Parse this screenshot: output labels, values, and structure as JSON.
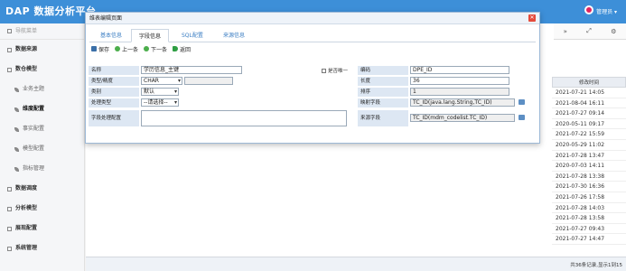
{
  "app": {
    "title": "DAP 数据分析平台"
  },
  "user": {
    "name": "管理员 ▾"
  },
  "sidebar": {
    "header": "导航菜单",
    "items": [
      {
        "label": "数据来源",
        "type": "group"
      },
      {
        "label": "数仓模型",
        "type": "group"
      },
      {
        "label": "业务主题",
        "type": "sub"
      },
      {
        "label": "维度配置",
        "type": "sub",
        "active": true
      },
      {
        "label": "事实配置",
        "type": "sub"
      },
      {
        "label": "模型配置",
        "type": "sub"
      },
      {
        "label": "指标管理",
        "type": "sub"
      },
      {
        "label": "数据调度",
        "type": "group"
      },
      {
        "label": "分析模型",
        "type": "group"
      },
      {
        "label": "展现配置",
        "type": "group"
      },
      {
        "label": "系统管理",
        "type": "group"
      }
    ]
  },
  "toolbar": {
    "icons": [
      "»",
      "⤢",
      "⚙"
    ]
  },
  "table": {
    "modified_header": "修改时间",
    "modified_times": [
      "2021-07-21 14:05",
      "2021-08-04 16:11",
      "2021-07-27 09:14",
      "2020-05-11 09:17",
      "2021-07-22 15:59",
      "2020-05-29 11:02",
      "2021-07-28 13:47",
      "2020-07-03 14:11",
      "2021-07-28 13:38",
      "2021-07-30 16:36",
      "2021-07-26 17:58",
      "2021-07-28 14:03",
      "2021-07-28 13:58",
      "2021-07-27 09:43",
      "2021-07-27 14:47"
    ],
    "footer": "共36条记录,显示1到15"
  },
  "modal": {
    "title": "维表编辑页面",
    "tabs": [
      "基本信息",
      "字段信息",
      "SQL配置",
      "来源信息"
    ],
    "active_tab": 1,
    "actions": {
      "save": "保存",
      "prev": "上一条",
      "next": "下一条",
      "back": "返回"
    },
    "form": {
      "name_label": "名称",
      "name_value": "学历信息_主键",
      "unique_label": "是否唯一",
      "code_label": "编码",
      "code_value": "DPE_ID",
      "type_label": "类型/精度",
      "type_value": "CHAR",
      "precision_value": "",
      "length_label": "长度",
      "length_value": "36",
      "category_label": "类别",
      "category_value": "默认",
      "sort_label": "排序",
      "sort_value": "1",
      "handler_label": "处理类型",
      "handler_value": "--请选择--",
      "mapping_label": "映射字段",
      "mapping_value": "TC_ID(java.lang.String,TC_ID)",
      "config_label": "字段处理配置",
      "config_value": "",
      "source_label": "来源字段",
      "source_value": "TC_ID(mdm_codelist.TC_ID)"
    }
  }
}
